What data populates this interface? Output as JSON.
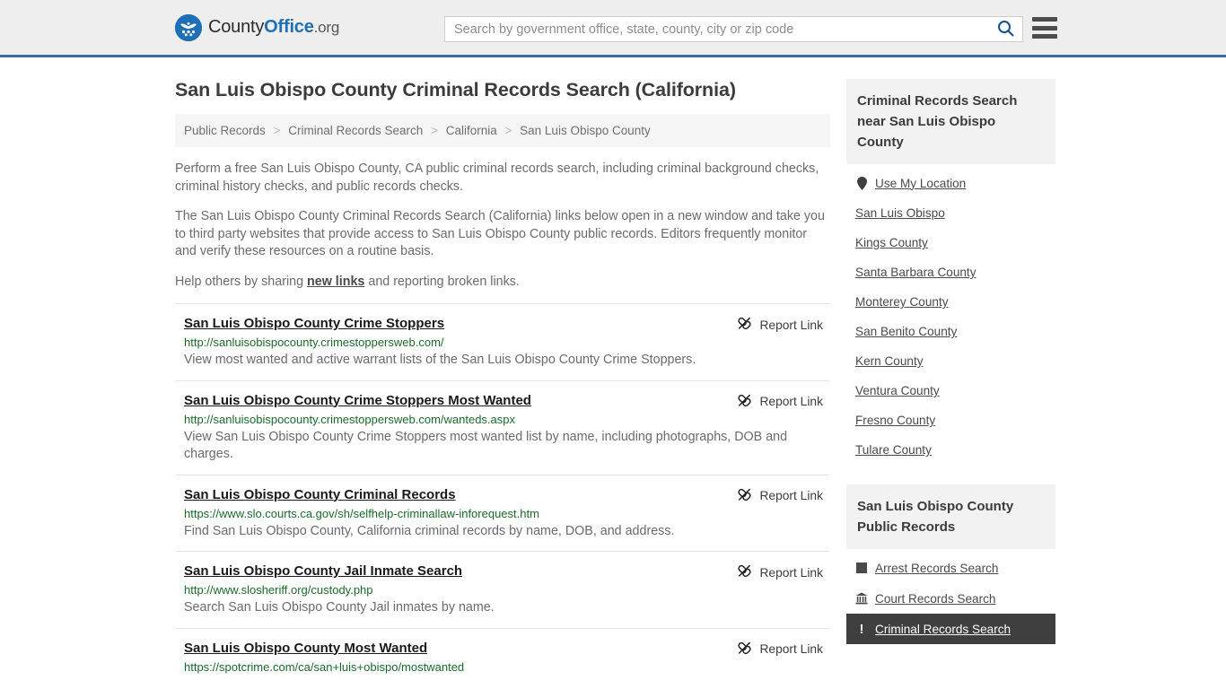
{
  "header": {
    "logo": {
      "icon": "eagle-seal-icon",
      "text_county": "County",
      "text_office": "Office",
      "text_org": ".org"
    },
    "search": {
      "placeholder": "Search by government office, state, county, city or zip code",
      "value": "",
      "icon": "search-icon"
    },
    "menu_icon": "hamburger-menu-icon"
  },
  "main": {
    "title": "San Luis Obispo County Criminal Records Search (California)",
    "breadcrumb": [
      "Public Records",
      "Criminal Records Search",
      "California",
      "San Luis Obispo County"
    ],
    "breadcrumb_separator": ">",
    "intro": {
      "p1": "Perform a free San Luis Obispo County, CA public criminal records search, including criminal background checks, criminal history checks, and public records checks.",
      "p2": "The San Luis Obispo County Criminal Records Search (California) links below open in a new window and take you to third party websites that provide access to San Luis Obispo County public records. Editors frequently monitor and verify these resources on a routine basis.",
      "p3_before": "Help others by sharing ",
      "p3_link": "new links",
      "p3_after": " and reporting broken links."
    },
    "report_link_label": "Report Link",
    "report_link_icon": "broken-link-icon",
    "results": [
      {
        "title": "San Luis Obispo County Crime Stoppers",
        "url": "http://sanluisobispocounty.crimestoppersweb.com/",
        "description": "View most wanted and active warrant lists of the San Luis Obispo County Crime Stoppers."
      },
      {
        "title": "San Luis Obispo County Crime Stoppers Most Wanted",
        "url": "http://sanluisobispocounty.crimestoppersweb.com/wanteds.aspx",
        "description": "View San Luis Obispo County Crime Stoppers most wanted list by name, including photographs, DOB and charges."
      },
      {
        "title": "San Luis Obispo County Criminal Records",
        "url": "https://www.slo.courts.ca.gov/sh/selfhelp-criminallaw-inforequest.htm",
        "description": "Find San Luis Obispo County, California criminal records by name, DOB, and address."
      },
      {
        "title": "San Luis Obispo County Jail Inmate Search",
        "url": "http://www.slosheriff.org/custody.php",
        "description": "Search San Luis Obispo County Jail inmates by name."
      },
      {
        "title": "San Luis Obispo County Most Wanted",
        "url": "https://spotcrime.com/ca/san+luis+obispo/mostwanted",
        "description": ""
      }
    ]
  },
  "rail": {
    "nearby": {
      "header": "Criminal Records Search near San Luis Obispo County",
      "items": [
        {
          "label": "Use My Location",
          "icon": "map-pin-icon"
        },
        {
          "label": "San Luis Obispo",
          "icon": ""
        },
        {
          "label": "Kings County",
          "icon": ""
        },
        {
          "label": "Santa Barbara County",
          "icon": ""
        },
        {
          "label": "Monterey County",
          "icon": ""
        },
        {
          "label": "San Benito County",
          "icon": ""
        },
        {
          "label": "Kern County",
          "icon": ""
        },
        {
          "label": "Ventura County",
          "icon": ""
        },
        {
          "label": "Fresno County",
          "icon": ""
        },
        {
          "label": "Tulare County",
          "icon": ""
        }
      ]
    },
    "public_records": {
      "header": "San Luis Obispo County Public Records",
      "items": [
        {
          "label": "Arrest Records Search",
          "icon": "square-icon",
          "active": false
        },
        {
          "label": "Court Records Search",
          "icon": "courthouse-icon",
          "active": false
        },
        {
          "label": "Criminal Records Search",
          "icon": "exclamation-icon",
          "active": true
        }
      ]
    }
  },
  "colors": {
    "header_bg": "#eeeeee",
    "header_border": "#3a6ea5",
    "brand_blue": "#1f6fb5",
    "url_green": "#1a6b2a",
    "active_bg": "#3f3f3f",
    "panel_bg": "#f2f2f2"
  }
}
